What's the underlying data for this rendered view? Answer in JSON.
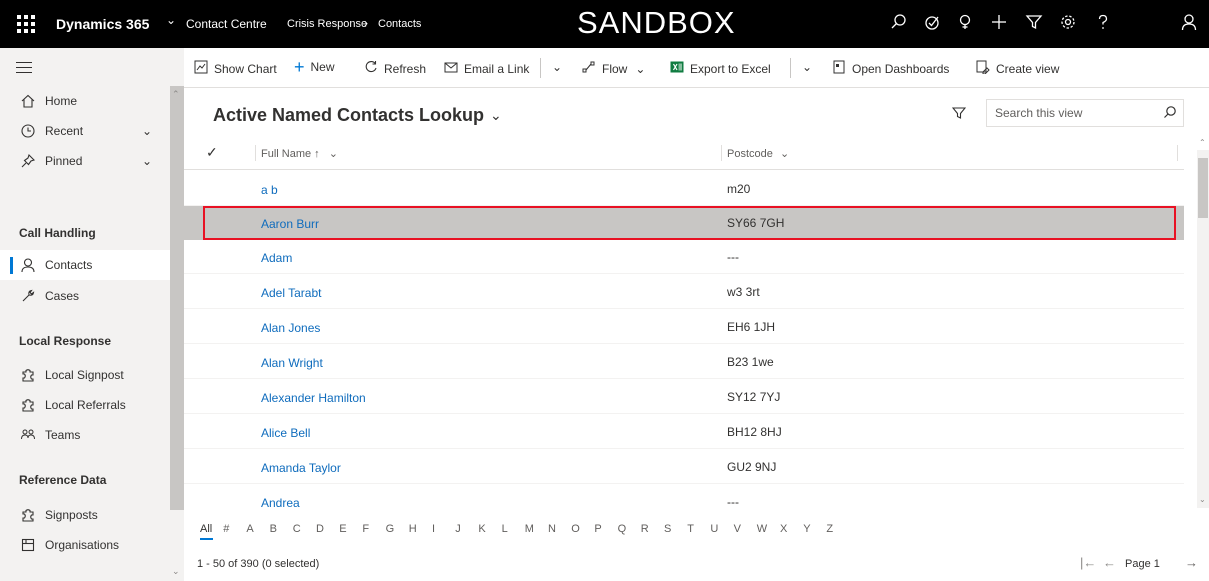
{
  "topbar": {
    "app_name": "Dynamics 365",
    "area": "Contact Centre",
    "breadcrumb": [
      "Crisis Response",
      "Contacts"
    ],
    "environment": "SANDBOX",
    "icons": [
      "search-icon",
      "task-icon",
      "lightbulb-icon",
      "plus-icon",
      "filter-icon",
      "gear-icon",
      "help-icon",
      "user-icon"
    ]
  },
  "commands": {
    "show_chart": "Show Chart",
    "new": "New",
    "refresh": "Refresh",
    "email_link": "Email a Link",
    "flow": "Flow",
    "export_excel": "Export to Excel",
    "open_dashboards": "Open Dashboards",
    "create_view": "Create view"
  },
  "sidebar": {
    "top": [
      {
        "label": "Home",
        "icon": "home-icon"
      },
      {
        "label": "Recent",
        "icon": "clock-icon"
      },
      {
        "label": "Pinned",
        "icon": "pin-icon"
      }
    ],
    "groups": [
      {
        "title": "Call Handling",
        "items": [
          {
            "label": "Contacts",
            "icon": "person-icon"
          },
          {
            "label": "Cases",
            "icon": "wrench-icon"
          }
        ]
      },
      {
        "title": "Local Response",
        "items": [
          {
            "label": "Local Signpost",
            "icon": "puzzle-icon"
          },
          {
            "label": "Local Referrals",
            "icon": "puzzle-icon"
          },
          {
            "label": "Teams",
            "icon": "team-icon"
          }
        ]
      },
      {
        "title": "Reference Data",
        "items": [
          {
            "label": "Signposts",
            "icon": "puzzle-icon"
          },
          {
            "label": "Organisations",
            "icon": "building-icon"
          }
        ]
      }
    ]
  },
  "view": {
    "title": "Active Named Contacts Lookup",
    "search_placeholder": "Search this view"
  },
  "grid": {
    "columns": [
      "Full Name ↑",
      "Postcode"
    ],
    "rows": [
      {
        "name": "a b",
        "postcode": "m20"
      },
      {
        "name": "Aaron Burr",
        "postcode": "SY66 7GH"
      },
      {
        "name": "Adam",
        "postcode": "---"
      },
      {
        "name": "Adel Tarabt",
        "postcode": "w3 3rt"
      },
      {
        "name": "Alan Jones",
        "postcode": "EH6 1JH"
      },
      {
        "name": "Alan Wright",
        "postcode": "B23 1we"
      },
      {
        "name": "Alexander Hamilton",
        "postcode": "SY12 7YJ"
      },
      {
        "name": "Alice Bell",
        "postcode": "BH12 8HJ"
      },
      {
        "name": "Amanda Taylor",
        "postcode": "GU2 9NJ"
      },
      {
        "name": "Andrea",
        "postcode": "---"
      }
    ],
    "selected_row": 1
  },
  "jumpbar": [
    "All",
    "#",
    "A",
    "B",
    "C",
    "D",
    "E",
    "F",
    "G",
    "H",
    "I",
    "J",
    "K",
    "L",
    "M",
    "N",
    "O",
    "P",
    "Q",
    "R",
    "S",
    "T",
    "U",
    "V",
    "W",
    "X",
    "Y",
    "Z"
  ],
  "footer": {
    "count": "1 - 50 of 390 (0 selected)",
    "page": "Page 1"
  }
}
